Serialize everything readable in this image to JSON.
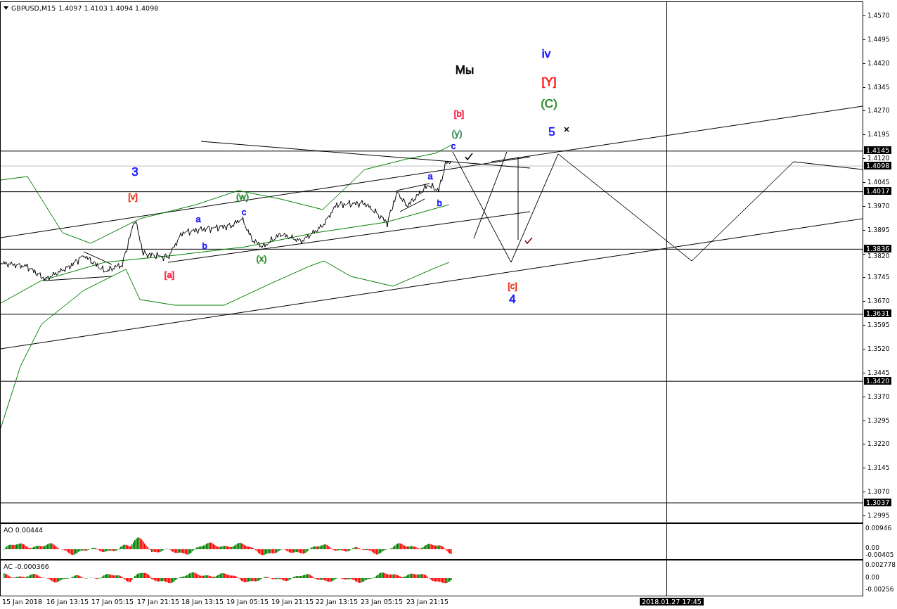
{
  "header": {
    "symbol": "GBPUSD,M15",
    "quote": "1.4097 1.4103 1.4094 1.4098"
  },
  "price_axis": {
    "ticks": [
      "1.4570",
      "1.4495",
      "1.4420",
      "1.4345",
      "1.4270",
      "1.4195",
      "1.4120",
      "1.4045",
      "1.3970",
      "1.3895",
      "1.3820",
      "1.3745",
      "1.3670",
      "1.3595",
      "1.3520",
      "1.3445",
      "1.3370",
      "1.3295",
      "1.3220",
      "1.3145",
      "1.3070",
      "1.2995"
    ],
    "levels": [
      {
        "value": "1.4145",
        "kind": "level"
      },
      {
        "value": "1.4098",
        "kind": "bid"
      },
      {
        "value": "1.4017",
        "kind": "level"
      },
      {
        "value": "1.3836",
        "kind": "level"
      },
      {
        "value": "1.3631",
        "kind": "level"
      },
      {
        "value": "1.3420",
        "kind": "level"
      },
      {
        "value": "1.3037",
        "kind": "level"
      }
    ]
  },
  "wave_labels": [
    {
      "text": "iv",
      "color": "#1515ff",
      "kind": "major"
    },
    {
      "text": "Мы",
      "color": "#000000",
      "kind": "major"
    },
    {
      "text": "[Y]",
      "color": "#ff1a1a",
      "kind": "major"
    },
    {
      "text": "(C)",
      "color": "#2e8b2e",
      "kind": "major"
    },
    {
      "text": "[b]",
      "color": "#ff1a3c",
      "kind": "minor"
    },
    {
      "text": "(y)",
      "color": "#3c8c5a",
      "kind": "minor"
    },
    {
      "text": "5",
      "color": "#1515ff",
      "kind": "major"
    },
    {
      "text": "c",
      "color": "#1515ff",
      "kind": "minor"
    },
    {
      "text": "3",
      "color": "#1515ff",
      "kind": "major"
    },
    {
      "text": "a",
      "color": "#1515ff",
      "kind": "minor"
    },
    {
      "text": "[v]",
      "color": "#e8301a",
      "kind": "minor"
    },
    {
      "text": "(w)",
      "color": "#2e8b2e",
      "kind": "minor"
    },
    {
      "text": "b",
      "color": "#1515ff",
      "kind": "minor"
    },
    {
      "text": "c",
      "color": "#1515ff",
      "kind": "minor"
    },
    {
      "text": "a",
      "color": "#1515ff",
      "kind": "minor"
    },
    {
      "text": "b",
      "color": "#1515ff",
      "kind": "minor"
    },
    {
      "text": "(x)",
      "color": "#2e8b2e",
      "kind": "minor"
    },
    {
      "text": "[a]",
      "color": "#ff1a3c",
      "kind": "minor"
    },
    {
      "text": "[c]",
      "color": "#e8301a",
      "kind": "minor"
    },
    {
      "text": "4",
      "color": "#1515ff",
      "kind": "major"
    }
  ],
  "indicators": [
    {
      "title": "AO 0.00444",
      "scale": [
        "0.00946",
        "0.00",
        "-0.00405"
      ]
    },
    {
      "title": "AC -0.000366",
      "scale": [
        "0.002778",
        "0.00",
        "-0.00256"
      ]
    }
  ],
  "time_axis": {
    "labels": [
      "15 Jan 2018",
      "16 Jan 13:15",
      "17 Jan 05:15",
      "17 Jan 21:15",
      "18 Jan 13:15",
      "19 Jan 05:15",
      "19 Jan 21:15",
      "22 Jan 13:15",
      "23 Jan 05:15",
      "23 Jan 21:15"
    ],
    "cursor": "2018.01.27 17:45"
  }
}
